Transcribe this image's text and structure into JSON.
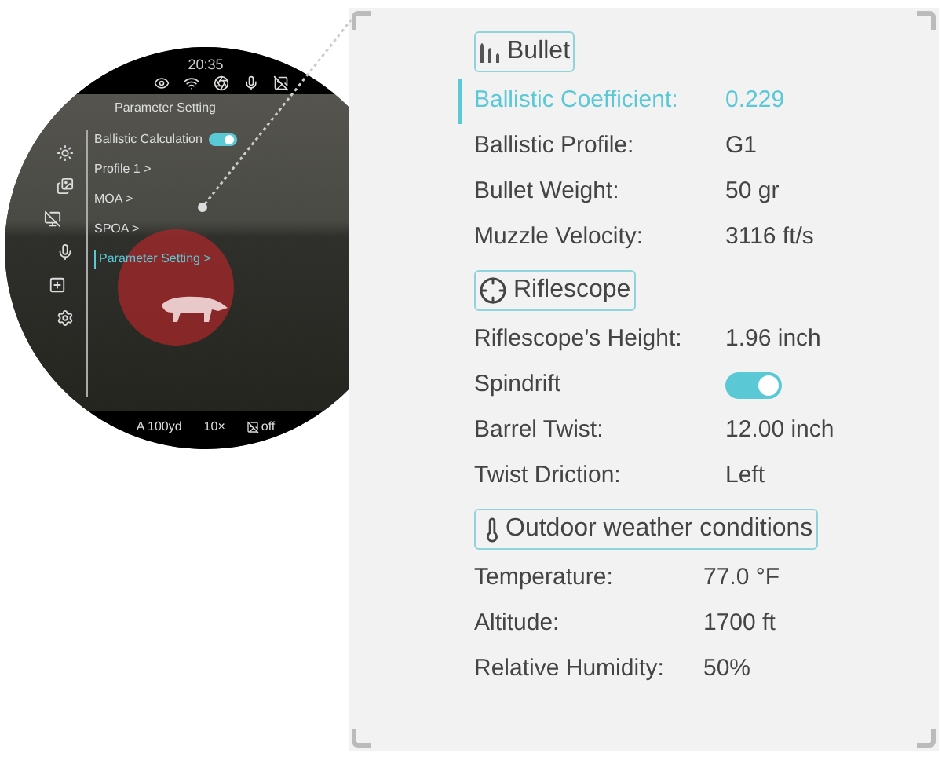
{
  "scope_view": {
    "time": "20:35",
    "menu_title": "Parameter Setting",
    "menu": [
      {
        "kind": "toggle",
        "label": "Ballistic Calculation",
        "on": true,
        "selected": false
      },
      {
        "kind": "link",
        "label": "Profile 1 >",
        "selected": false
      },
      {
        "kind": "link",
        "label": "MOA >",
        "selected": false
      },
      {
        "kind": "link",
        "label": "SPOA >",
        "selected": false
      },
      {
        "kind": "link",
        "label": "Parameter Setting >",
        "selected": true
      }
    ],
    "status": [
      "A 100yd",
      "10×",
      "off"
    ]
  },
  "sections": [
    {
      "kind": "bullet",
      "title": "Bullet",
      "rows": [
        {
          "kind": "text",
          "label": "Ballistic Coefficient:",
          "value": "0.229",
          "selected": true
        },
        {
          "kind": "text",
          "label": "Ballistic Profile:",
          "value": "G1",
          "selected": false
        },
        {
          "kind": "text",
          "label": "Bullet Weight:",
          "value": "50 gr",
          "selected": false
        },
        {
          "kind": "text",
          "label": "Muzzle Velocity:",
          "value": "3116 ft/s",
          "selected": false
        }
      ]
    },
    {
      "kind": "riflescope",
      "title": "Riflescope",
      "rows": [
        {
          "kind": "text",
          "label": "Riflescope’s Height:",
          "value": "1.96 inch",
          "selected": false
        },
        {
          "kind": "toggle",
          "label": "Spindrift",
          "on": true,
          "selected": false
        },
        {
          "kind": "text",
          "label": "Barrel Twist:",
          "value": "12.00 inch",
          "selected": false
        },
        {
          "kind": "text",
          "label": "Twist Driction:",
          "value": "Left",
          "selected": false
        }
      ]
    },
    {
      "kind": "weather",
      "title": "Outdoor weather conditions",
      "rows": [
        {
          "kind": "text",
          "label": "Temperature:",
          "value": "77.0 °F",
          "selected": false
        },
        {
          "kind": "text",
          "label": "Altitude:",
          "value": "1700 ft",
          "selected": false
        },
        {
          "kind": "text",
          "label": "Relative Humidity:",
          "value": "50%",
          "selected": false
        }
      ]
    }
  ]
}
